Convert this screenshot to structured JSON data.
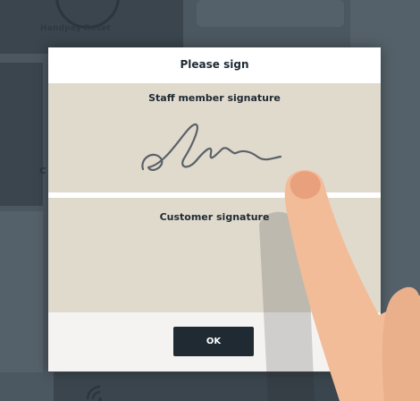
{
  "background": {
    "handpay_label": "Handpay Reset",
    "side_letter": "C"
  },
  "dialog": {
    "title": "Please sign",
    "staff_label": "Staff member signature",
    "customer_label": "Customer signature",
    "ok_label": "OK"
  },
  "colors": {
    "pad": "#e0dacd",
    "button": "#1f2a33",
    "backdrop": "#4c5861",
    "finger": "#f2bc98"
  },
  "icons": [
    "wifi-icon",
    "signature-stroke",
    "finger-hand"
  ]
}
